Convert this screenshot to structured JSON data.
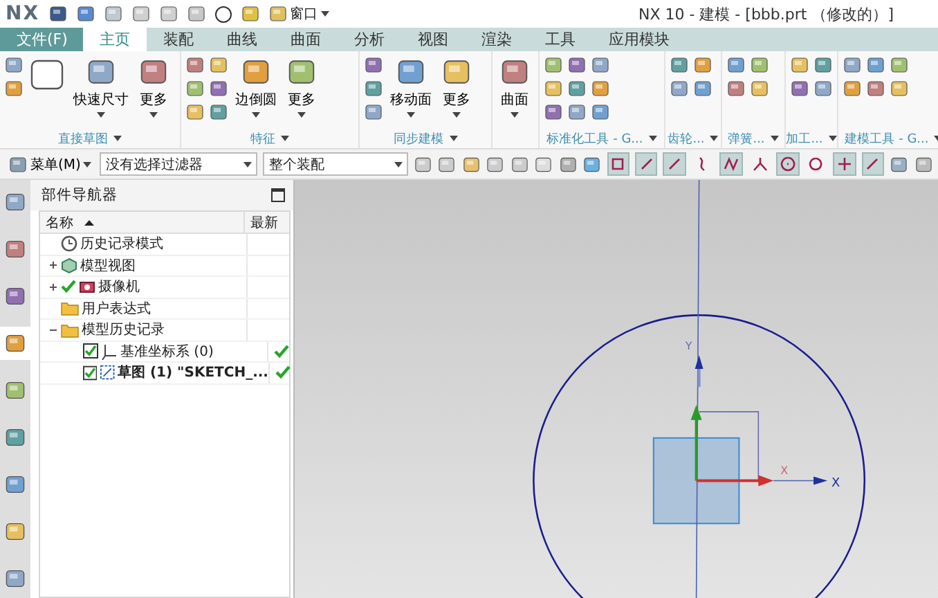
{
  "window": {
    "logo": "NX",
    "title": "NX 10 - 建模 - [bbb.prt （修改的）]"
  },
  "quick_access": {
    "window_menu": "窗口"
  },
  "file_button": "文件(F)",
  "tabs": [
    {
      "label": "主页",
      "selected": true
    },
    {
      "label": "装配",
      "selected": false
    },
    {
      "label": "曲线",
      "selected": false
    },
    {
      "label": "曲面",
      "selected": false
    },
    {
      "label": "分析",
      "selected": false
    },
    {
      "label": "视图",
      "selected": false
    },
    {
      "label": "渲染",
      "selected": false
    },
    {
      "label": "工具",
      "selected": false
    },
    {
      "label": "应用模块",
      "selected": false
    }
  ],
  "ribbon_groups": [
    {
      "label": "直接草图",
      "buttons": [
        "快速尺寸",
        "更多"
      ]
    },
    {
      "label": "特征",
      "buttons": [
        "边倒圆",
        "更多"
      ]
    },
    {
      "label": "同步建模",
      "buttons": [
        "移动面",
        "更多"
      ]
    },
    {
      "buttons": [
        "曲面"
      ]
    },
    {
      "label": "标准化工具 - G..."
    },
    {
      "label": "齿轮..."
    },
    {
      "label": "弹簧..."
    },
    {
      "label": "加工..."
    },
    {
      "label": "建模工具 - G..."
    }
  ],
  "toolbar": {
    "menu": "菜单(M)",
    "selection_filter": "没有选择过滤器",
    "scope": "整个装配",
    "snap_tools": [
      {
        "on": true
      },
      {
        "on": true
      },
      {
        "on": true
      },
      {
        "on": false
      },
      {
        "on": true
      },
      {
        "on": false
      },
      {
        "on": true
      },
      {
        "on": false
      },
      {
        "on": true
      },
      {
        "on": true
      }
    ]
  },
  "sidebar": {
    "items": [
      {
        "selected": false
      },
      {
        "selected": false
      },
      {
        "selected": false
      },
      {
        "selected": true
      },
      {
        "selected": false
      },
      {
        "selected": false
      },
      {
        "selected": false
      },
      {
        "selected": false
      },
      {
        "selected": false
      }
    ]
  },
  "navigator": {
    "title": "部件导航器",
    "columns": [
      "名称",
      "最新"
    ],
    "tree": [
      {
        "kind": "history",
        "label": "历史记录模式"
      },
      {
        "kind": "views",
        "label": "模型视图",
        "expanded": false
      },
      {
        "kind": "camera",
        "label": "摄像机",
        "expanded": false,
        "active": true
      },
      {
        "kind": "folder",
        "label": "用户表达式"
      },
      {
        "kind": "folder",
        "label": "模型历史记录",
        "expanded": true,
        "children": [
          {
            "kind": "datum",
            "label": "基准坐标系 (0)",
            "checked": true,
            "latest": true
          },
          {
            "kind": "sketch",
            "label": "草图 (1) \"SKETCH_...",
            "checked": true,
            "latest": true,
            "bold": true
          }
        ]
      }
    ]
  },
  "viewport": {
    "labels": {
      "y": "Y",
      "x_sketch": "X",
      "x_datum": "X"
    }
  }
}
